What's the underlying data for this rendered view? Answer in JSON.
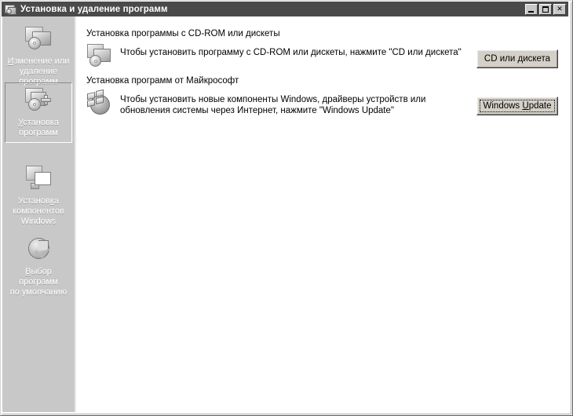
{
  "window": {
    "title": "Установка и удаление программ",
    "title_icon": "add-remove-programs-icon",
    "minimize_label": "_",
    "maximize_label": "□",
    "close_label": "✕"
  },
  "sidebar": {
    "items": [
      {
        "id": "change-remove-programs",
        "icon": "monitor-disc-icon",
        "label_lines": [
          "Изменение или",
          "удаление",
          "программ"
        ],
        "label": "Изменение или удаление программ",
        "accelerator": "И",
        "selected": false
      },
      {
        "id": "add-new-programs",
        "icon": "monitor-disc-plus-icon",
        "label_lines": [
          "Установка",
          "программ"
        ],
        "label": "Установка программ",
        "accelerator": "У",
        "selected": true
      },
      {
        "id": "add-remove-windows-components",
        "icon": "windows-components-icon",
        "label_lines": [
          "Установка",
          "компонентов",
          "Windows"
        ],
        "label": "Установка компонентов Windows",
        "accelerator": "к",
        "selected": false
      },
      {
        "id": "set-program-access-defaults",
        "icon": "default-programs-pie-icon",
        "label_lines": [
          "Выбор",
          "программ",
          "по умолчанию"
        ],
        "label": "Выбор программ по умолчанию",
        "accelerator": "В",
        "selected": false
      }
    ]
  },
  "main": {
    "sections": [
      {
        "id": "install-from-cdrom",
        "heading": "Установка программы с CD-ROM или дискеты",
        "icon": "cd-folder-icon",
        "description": "Чтобы установить программу с CD-ROM или дискеты, нажмите \"CD или дискета\"",
        "button": {
          "label_before": "CD или ",
          "accelerator": "д",
          "label_after": "искета",
          "label": "CD или дискета",
          "focused": false
        }
      },
      {
        "id": "install-from-microsoft",
        "heading": "Установка программ от Майкрософт",
        "icon": "windows-update-globe-icon",
        "description_lines": [
          "Чтобы установить новые компоненты Windows, драйверы устройств или обновления",
          "системы через Интернет, нажмите \"Windows Update\""
        ],
        "description": "Чтобы установить новые компоненты Windows, драйверы устройств или обновления системы через Интернет, нажмите \"Windows Update\"",
        "button": {
          "label_before": "Windows ",
          "accelerator": "U",
          "label_after": "pdate",
          "label": "Windows Update",
          "focused": true
        }
      }
    ]
  },
  "colors": {
    "titlebar_bg": "#4a4a4a",
    "titlebar_text": "#ffffff",
    "sidebar_bg": "#c8c8c8",
    "sidebar_text": "#ffffff",
    "content_bg": "#ffffff",
    "button_face": "#d4d0c8",
    "text": "#000000"
  }
}
